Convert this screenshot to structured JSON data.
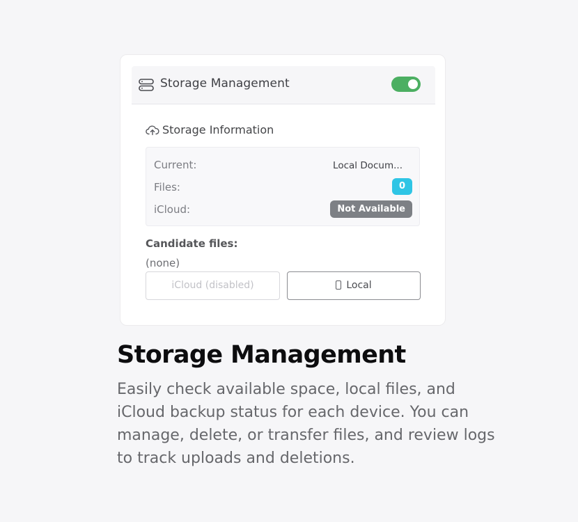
{
  "panel": {
    "title": "Storage Management",
    "toggle_on": true,
    "toggle_color": "#4caf62"
  },
  "storage_info": {
    "title": "Storage Information",
    "icon": "cloud-upload-icon",
    "current_label": "Current:",
    "current_value": "Local Docum...",
    "files_label": "Files:",
    "files_value": "0",
    "files_badge_color": "#2fc5e5",
    "icloud_label": "iCloud:",
    "icloud_value": "Not Available",
    "icloud_badge_color": "#7d8085"
  },
  "candidates": {
    "label": "Candidate files:",
    "value": "(none)"
  },
  "buttons": {
    "icloud_label": "iCloud (disabled)",
    "local_label": "Local",
    "local_icon": "phone-icon"
  },
  "feature": {
    "heading": "Storage Management",
    "description": "Easily check available space, local files, and iCloud backup status for each device. You can manage, delete, or transfer files, and review logs to track uploads and deletions."
  }
}
